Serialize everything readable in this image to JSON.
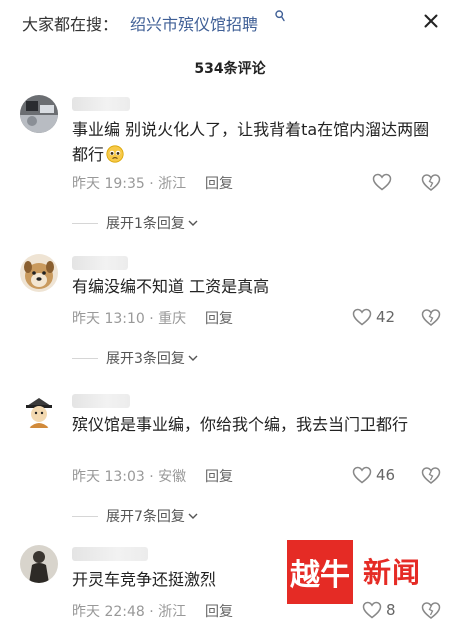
{
  "search": {
    "prefix": "大家都在搜：",
    "query": "绍兴市殡仪馆招聘",
    "icon": "search-icon"
  },
  "header": {
    "comment_count": "534条评论",
    "close_icon": "close-icon"
  },
  "comments": [
    {
      "text": "事业编 别说火化人了，让我背着ta在馆内溜达两圈都行",
      "emoji": "pleading-face-emoji",
      "time": "昨天 19:35 · 浙江",
      "reply_label": "回复",
      "likes": "",
      "expand_label": "展开1条回复"
    },
    {
      "text": "有编没编不知道 工资是真高",
      "time": "昨天 13:10 · 重庆",
      "reply_label": "回复",
      "likes": "42",
      "expand_label": "展开3条回复"
    },
    {
      "text": "殡仪馆是事业编，你给我个编，我去当门卫都行",
      "time": "昨天 13:03 · 安徽",
      "reply_label": "回复",
      "likes": "46",
      "expand_label": "展开7条回复"
    },
    {
      "text": "开灵车竞争还挺激烈",
      "time": "昨天 22:48 · 浙江",
      "reply_label": "回复",
      "likes": "8"
    }
  ],
  "watermark": {
    "logo_char": "越牛",
    "logo_text": "新闻",
    "brand_color": "#e52b25"
  },
  "colors": {
    "link": "#3f5f96",
    "meta": "#999999"
  }
}
